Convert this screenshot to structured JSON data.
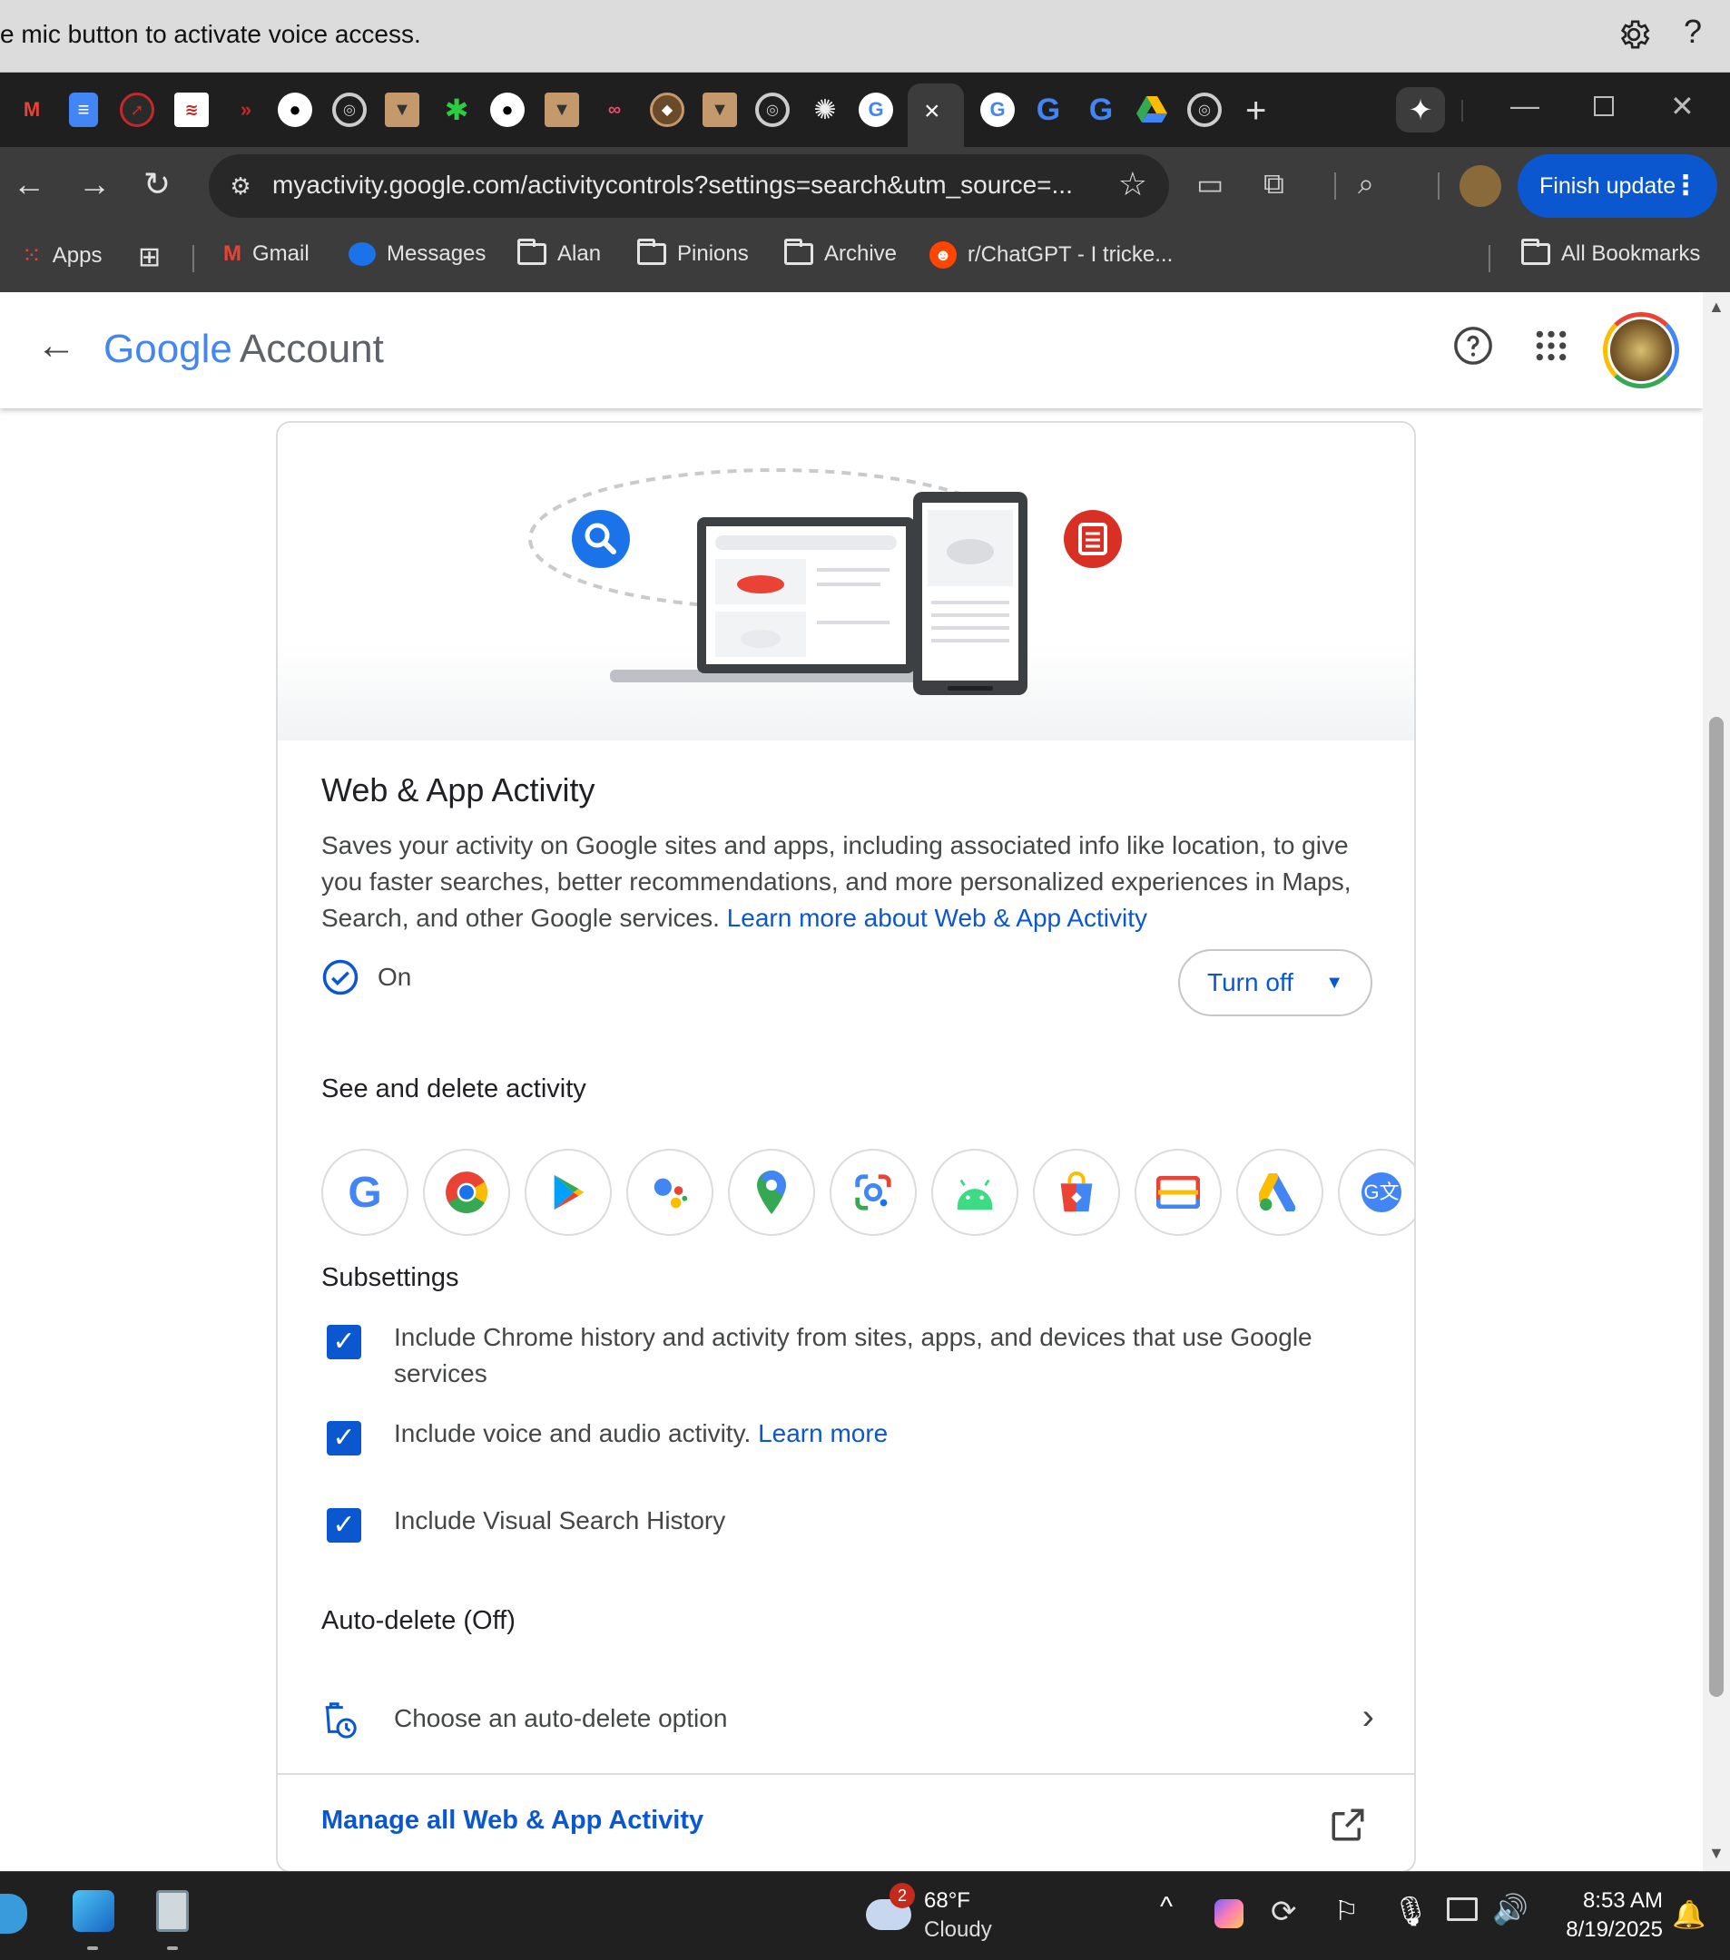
{
  "voice_bar": {
    "message": "e mic button to activate voice access.",
    "help": "?"
  },
  "tabs": {
    "active_close": "×",
    "new_tab": "+",
    "gemini": "✦"
  },
  "toolbar": {
    "url": "myactivity.google.com/activitycontrols?settings=search&utm_source=...",
    "finish_update": "Finish update"
  },
  "bookmarks": {
    "apps": "Apps",
    "items": [
      "Gmail",
      "Messages",
      "Alan",
      "Pinions",
      "Archive",
      "r/ChatGPT - I tricke..."
    ],
    "all": "All Bookmarks"
  },
  "header": {
    "logo_google": "Google",
    "logo_account": "Account"
  },
  "card": {
    "title": "Web & App Activity",
    "description": "Saves your activity on Google sites and apps, including associated info like location, to give you faster searches, better recommendations, and more personalized experiences in Maps, Search, and other Google services.",
    "learn_more_link": "Learn more about Web & App Activity",
    "status": "On",
    "turn_off": "Turn off",
    "see_delete": "See and delete activity",
    "subsettings": "Subsettings",
    "checks": [
      {
        "label": "Include Chrome history and activity from sites, apps, and devices that use Google services"
      },
      {
        "label": "Include voice and audio activity.",
        "link": "Learn more"
      },
      {
        "label": "Include Visual Search History"
      }
    ],
    "auto_delete_heading": "Auto-delete (Off)",
    "auto_delete_option": "Choose an auto-delete option",
    "manage": "Manage all Web & App Activity"
  },
  "taskbar": {
    "weather_badge": "2",
    "temperature": "68°F",
    "condition": "Cloudy",
    "time": "8:53 AM",
    "date": "8/19/2025"
  }
}
